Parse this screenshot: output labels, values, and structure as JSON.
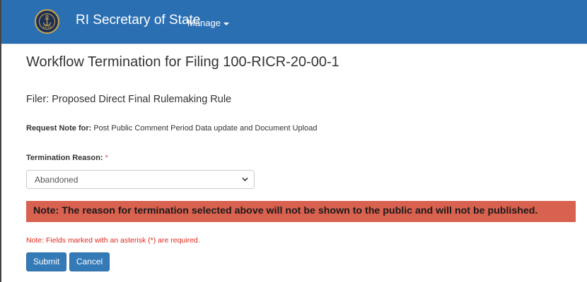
{
  "navbar": {
    "brand": "RI Secretary of State",
    "seal_year": "1636",
    "manage_label": "Manage",
    "background_color": "#2b6fb3"
  },
  "page": {
    "title": "Workflow Termination for Filing 100-RICR-20-00-1",
    "filer": "Filer: Proposed Direct Final Rulemaking Rule",
    "request_note_label": "Request Note for:",
    "request_note_value": "Post Public Comment Period Data update and Document Upload"
  },
  "form": {
    "termination_label": "Termination Reason:",
    "required_marker": "*",
    "termination_value": "Abandoned",
    "warning": "Note: The reason for termination selected above will not be shown to the public and will not be published.",
    "warning_color": "#d9614f",
    "required_note": "Note: Fields marked with an asterisk (*) are required.",
    "submit_label": "Submit",
    "cancel_label": "Cancel",
    "button_color": "#337ab7"
  },
  "icons": {
    "seal": "state-seal-anchor-icon",
    "manage_caret": "caret-down-icon",
    "select_chevron": "chevron-down-icon"
  }
}
